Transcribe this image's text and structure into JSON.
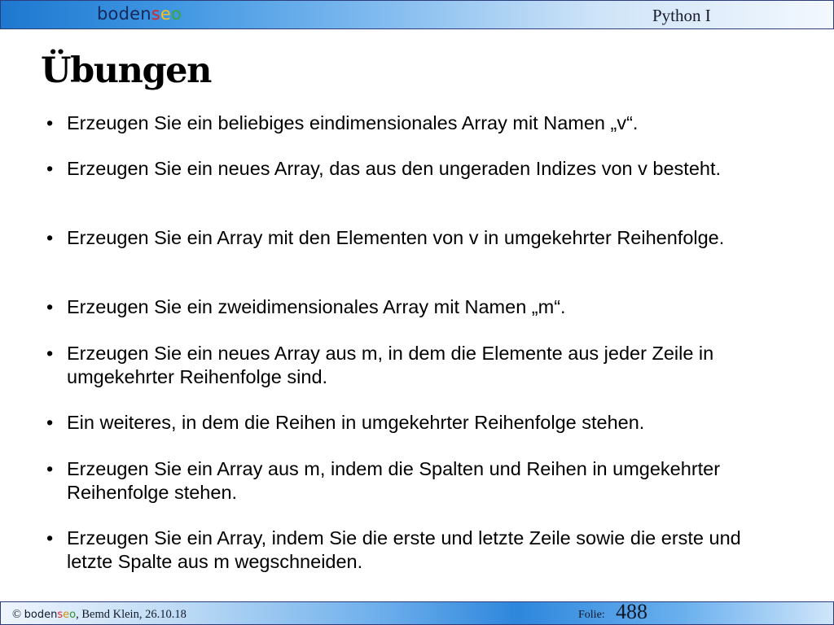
{
  "header": {
    "logo": {
      "parts": [
        "boden",
        "s",
        "e",
        "o"
      ],
      "colors": {
        "base": "#16275a",
        "s": "#d9262b",
        "e": "#f4c21b",
        "o": "#3aa63c"
      }
    },
    "course": "Python I"
  },
  "title": "Übungen",
  "bullets": [
    "Erzeugen Sie ein beliebiges eindimensionales Array mit Namen „v“.",
    "Erzeugen Sie ein neues Array, das aus den ungeraden Indizes von v besteht.",
    "Erzeugen Sie ein Array mit den Elementen von  v in umgekehrter Reihenfolge.",
    "Erzeugen Sie ein zweidimensionales Array mit Namen „m“.",
    "Erzeugen Sie ein neues Array aus m, in dem die Elemente aus jeder Zeile in umgekehrter Reihenfolge sind.",
    "Ein weiteres, in dem die Reihen in umgekehrter Reihenfolge stehen.",
    "Erzeugen Sie ein Array aus m, indem die Spalten und Reihen in umgekehrter Reihenfolge stehen.",
    "Erzeugen Sie ein Array, indem Sie die erste und letzte Zeile sowie die erste und letzte Spalte aus m wegschneiden."
  ],
  "bullet_symbol": "•",
  "footer": {
    "copyright_symbol": "©",
    "brand_parts": [
      "boden",
      "s",
      "e",
      "o"
    ],
    "author_date": ", Bemd Klein, 26.10.18",
    "folie_label": "Folie:",
    "folie_number": "488"
  },
  "colors": {
    "header_start": "#1e78cf",
    "header_end": "#f3f8fe",
    "footer_mid": "#2e87dc",
    "border": "#2d3c7a"
  }
}
